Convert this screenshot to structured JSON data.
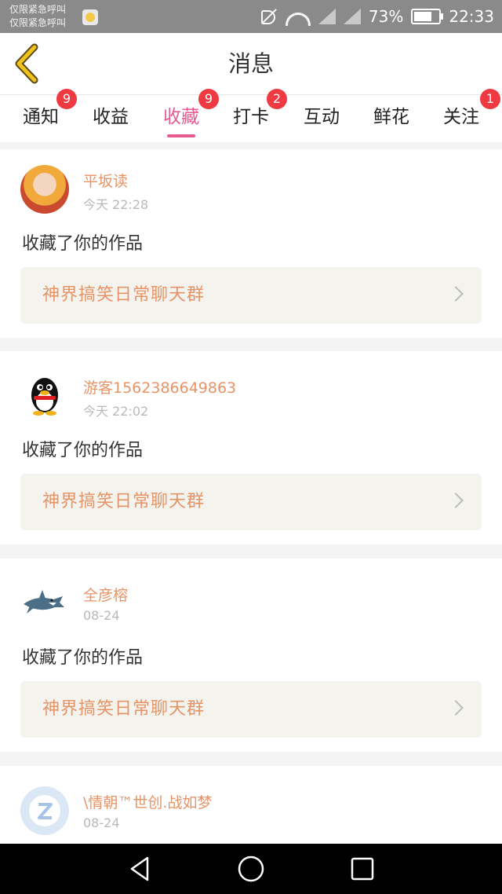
{
  "status_bar": {
    "carrier_line1": "仅限紧急呼叫",
    "carrier_line2": "仅限紧急呼叫",
    "battery_percent": "73%",
    "time": "22:33",
    "app_icon": "face-icon",
    "icons": [
      "mute-icon",
      "wifi-icon",
      "signal-icon",
      "signal-icon",
      "battery-icon"
    ]
  },
  "header": {
    "title": "消息",
    "back_icon": "chevron-left-icon",
    "accent": "#f0c21a"
  },
  "tabs": [
    {
      "label": "通知",
      "badge": "9",
      "active": false
    },
    {
      "label": "收益",
      "badge": "",
      "active": false
    },
    {
      "label": "收藏",
      "badge": "9",
      "active": true
    },
    {
      "label": "打卡",
      "badge": "2",
      "active": false
    },
    {
      "label": "互动",
      "badge": "",
      "active": false
    },
    {
      "label": "鲜花",
      "badge": "",
      "active": false
    },
    {
      "label": "关注",
      "badge": "1",
      "active": false
    }
  ],
  "colors": {
    "active_tab": "#e65a8f",
    "badge": "#ef3a42",
    "username": "#e69467",
    "work_title": "#e69467"
  },
  "messages": [
    {
      "username": "平坂读",
      "time": "今天 22:28",
      "action": "收藏了你的作品",
      "work": "神界搞笑日常聊天群"
    },
    {
      "username": "游客1562386649863",
      "time": "今天 22:02",
      "action": "收藏了你的作品",
      "work": "神界搞笑日常聊天群"
    },
    {
      "username": "全彦榕",
      "time": "08-24",
      "action": "收藏了你的作品",
      "work": "神界搞笑日常聊天群"
    },
    {
      "username": "\\情朝™世创.战如梦",
      "time": "08-24",
      "action": "",
      "work": ""
    }
  ],
  "nav_bar": {
    "icons": [
      "back-triangle-icon",
      "home-circle-icon",
      "recent-square-icon"
    ]
  }
}
